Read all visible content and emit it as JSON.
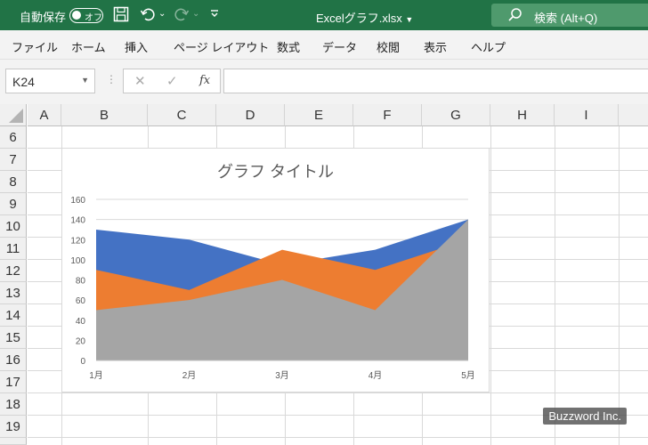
{
  "titlebar": {
    "autosave_label": "自動保存",
    "autosave_toggle": "オフ",
    "file_title": "Excelグラフ.xlsx",
    "search_label": "検索 (Alt+Q)"
  },
  "ribbon_tabs": [
    "ファイル",
    "ホーム",
    "挿入",
    "ページ レイアウト",
    "数式",
    "データ",
    "校閲",
    "表示",
    "ヘルプ"
  ],
  "formula_bar": {
    "name_box": "K24",
    "formula": ""
  },
  "columns": [
    "A",
    "B",
    "C",
    "D",
    "E",
    "F",
    "G",
    "H",
    "I"
  ],
  "rows": [
    "6",
    "7",
    "8",
    "9",
    "10",
    "11",
    "12",
    "13",
    "14",
    "15",
    "16",
    "17",
    "18",
    "19",
    "20"
  ],
  "chart_data": {
    "type": "area",
    "title": "グラフ タイトル",
    "categories": [
      "1月",
      "2月",
      "3月",
      "4月",
      "5月"
    ],
    "ylim": [
      0,
      160
    ],
    "yticks": [
      "0",
      "20",
      "40",
      "60",
      "80",
      "100",
      "120",
      "140",
      "160"
    ],
    "grid": true,
    "series": [
      {
        "values": [
          130,
          120,
          95,
          110,
          140
        ],
        "color": "#4472c4"
      },
      {
        "values": [
          90,
          70,
          110,
          90,
          120
        ],
        "color": "#ed7d31"
      },
      {
        "values": [
          50,
          60,
          80,
          50,
          140
        ],
        "color": "#a5a5a5"
      }
    ]
  },
  "watermark": "Buzzword Inc."
}
